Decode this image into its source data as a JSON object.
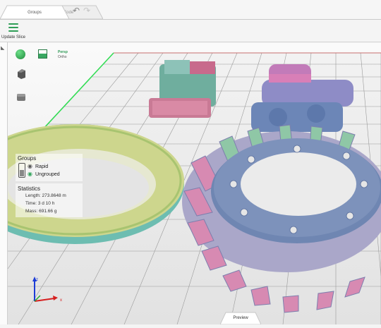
{
  "tabs": [
    {
      "label": "Groups",
      "active": true
    },
    {
      "label": "Code",
      "active": false
    }
  ],
  "toolbar": {
    "undo_icon": "undo-icon",
    "redo_icon": "redo-icon",
    "menu_icon": "hamburger-menu-icon",
    "update_slice_label": "Update Slice"
  },
  "view_controls": {
    "persp_label": "Persp",
    "ortho_label": "Ortho"
  },
  "groups_panel": {
    "title": "Groups",
    "items": [
      {
        "label": "Rapid",
        "visible": true
      },
      {
        "label": "Ungrouped",
        "visible": true
      }
    ]
  },
  "statistics": {
    "title": "Statistics",
    "length": "Length: 273.8648 m",
    "time": "Time: 3 d 10 h",
    "mass": "Mass: 691.66 g"
  },
  "axis_labels": {
    "z": "z",
    "x": "x"
  },
  "bottom_tab": {
    "label": "Preview"
  },
  "colors": {
    "accent": "#2f9e57",
    "model_blue": "#6f83b0",
    "model_pink": "#d77fb0",
    "model_teal": "#6ec9ba",
    "model_olive": "#c8d47b"
  }
}
